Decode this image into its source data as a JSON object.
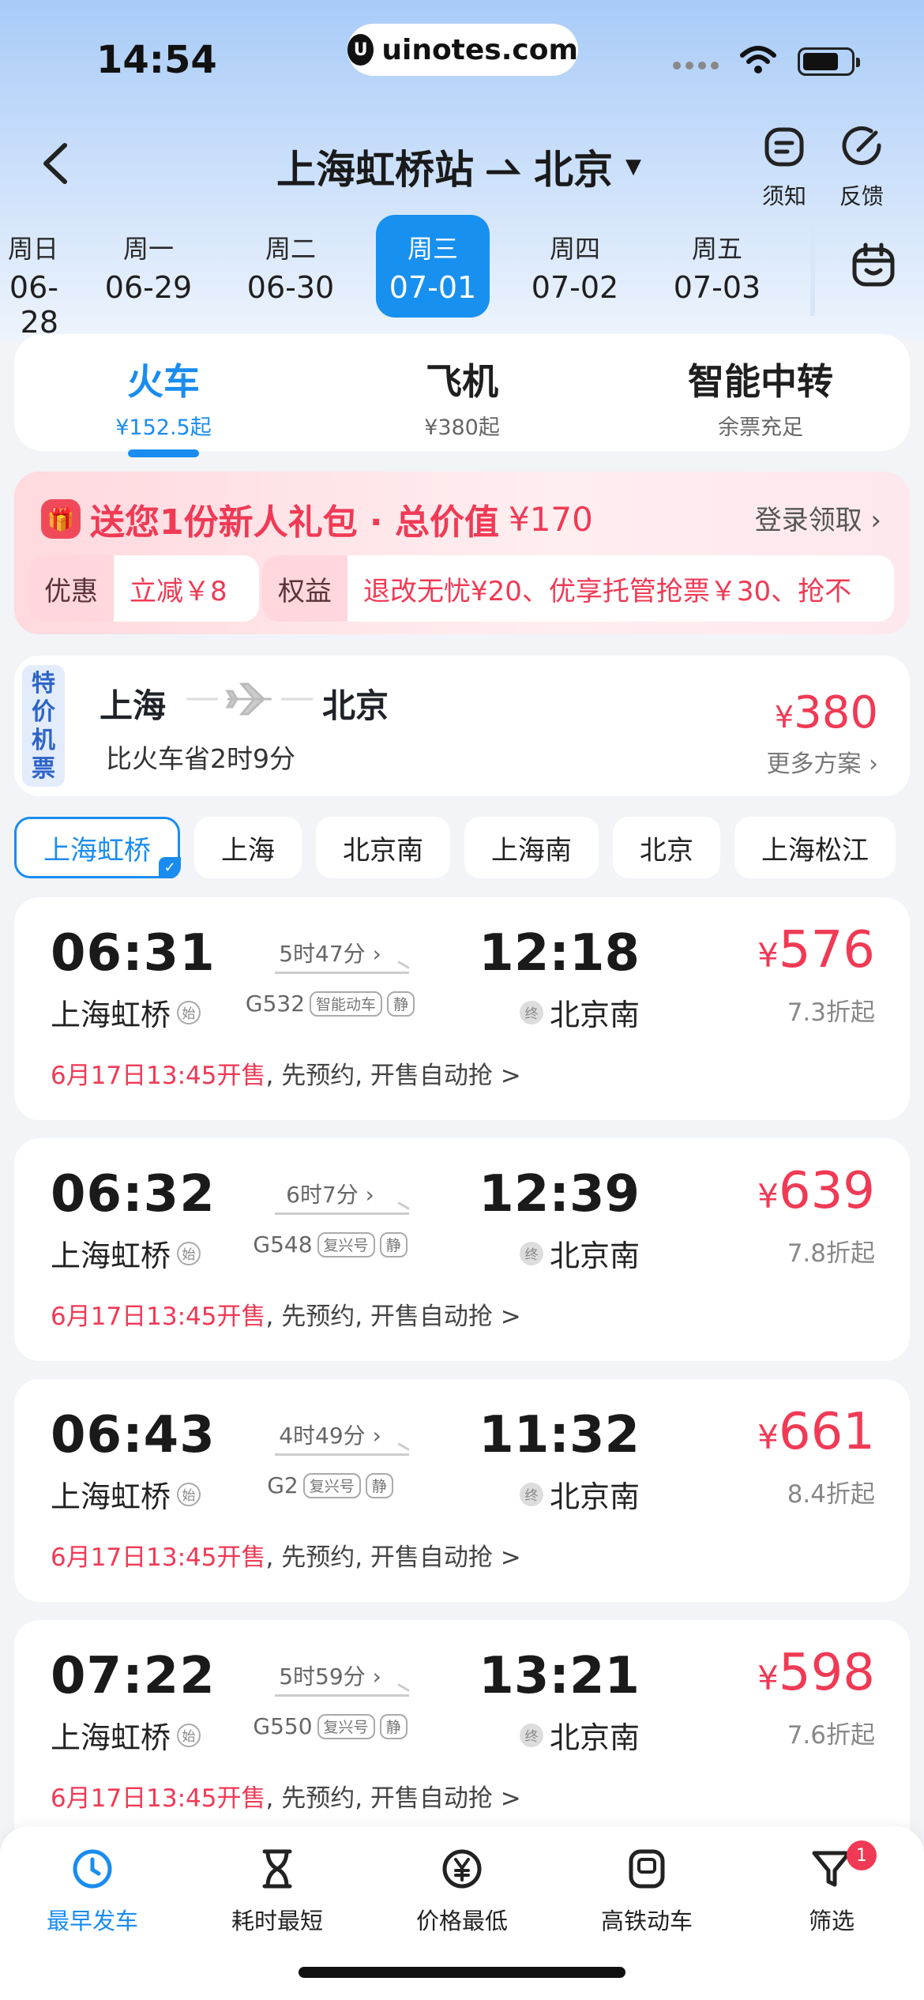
{
  "status_bar": {
    "time": "14:54",
    "watermark": "uinotes.com"
  },
  "header": {
    "from": "上海虹桥站",
    "to": "北京",
    "notice_label": "须知",
    "feedback_label": "反馈"
  },
  "dates": [
    {
      "weekday": "周日",
      "date": "06-28",
      "selected": false
    },
    {
      "weekday": "周一",
      "date": "06-29",
      "selected": false
    },
    {
      "weekday": "周二",
      "date": "06-30",
      "selected": false
    },
    {
      "weekday": "周三",
      "date": "07-01",
      "selected": true
    },
    {
      "weekday": "周四",
      "date": "07-02",
      "selected": false
    },
    {
      "weekday": "周五",
      "date": "07-03",
      "selected": false
    }
  ],
  "modes": [
    {
      "name": "火车",
      "sub": "¥152.5起",
      "active": true
    },
    {
      "name": "飞机",
      "sub": "¥380起",
      "active": false
    },
    {
      "name": "智能中转",
      "sub": "余票充足",
      "active": false
    }
  ],
  "promo": {
    "headline": "送您1份新人礼包 · 总价值",
    "amount": "¥170",
    "login_label": "登录领取",
    "chip1_label": "优惠",
    "chip1_value": "立减￥8",
    "chip2_label": "权益",
    "chip2_value": "退改无忧¥20、优享托管抢票￥30、抢不"
  },
  "flight_offer": {
    "badge": "特价机票",
    "from": "上海",
    "to": "北京",
    "desc": "比火车省2时9分",
    "price_symbol": "¥",
    "price": "380",
    "more_label": "更多方案"
  },
  "stations": [
    "上海虹桥",
    "上海",
    "北京南",
    "上海南",
    "北京",
    "上海松江"
  ],
  "trains": [
    {
      "dep": "06:31",
      "dep_station": "上海虹桥",
      "dep_tag": "始",
      "duration": "5时47分",
      "number": "G532",
      "type": "智能动车",
      "quiet": "静",
      "arr": "12:18",
      "arr_station": "北京南",
      "arr_tag": "终",
      "price": "576",
      "discount": "7.3折起",
      "sale_time": "6月17日13:45开售",
      "sale_note": ", 先预约, 开售自动抢 >"
    },
    {
      "dep": "06:32",
      "dep_station": "上海虹桥",
      "dep_tag": "始",
      "duration": "6时7分",
      "number": "G548",
      "type": "复兴号",
      "quiet": "静",
      "arr": "12:39",
      "arr_station": "北京南",
      "arr_tag": "终",
      "price": "639",
      "discount": "7.8折起",
      "sale_time": "6月17日13:45开售",
      "sale_note": ", 先预约, 开售自动抢 >"
    },
    {
      "dep": "06:43",
      "dep_station": "上海虹桥",
      "dep_tag": "始",
      "duration": "4时49分",
      "number": "G2",
      "type": "复兴号",
      "quiet": "静",
      "arr": "11:32",
      "arr_station": "北京南",
      "arr_tag": "终",
      "price": "661",
      "discount": "8.4折起",
      "sale_time": "6月17日13:45开售",
      "sale_note": ", 先预约, 开售自动抢 >"
    },
    {
      "dep": "07:22",
      "dep_station": "上海虹桥",
      "dep_tag": "始",
      "duration": "5时59分",
      "number": "G550",
      "type": "复兴号",
      "quiet": "静",
      "arr": "13:21",
      "arr_station": "北京南",
      "arr_tag": "终",
      "price": "598",
      "discount": "7.6折起",
      "sale_time": "6月17日13:45开售",
      "sale_note": ", 先预约, 开售自动抢 >"
    }
  ],
  "price_symbol": "¥",
  "bottom_nav": [
    {
      "label": "最早发车",
      "icon": "clock-icon",
      "active": true
    },
    {
      "label": "耗时最短",
      "icon": "hourglass-icon",
      "active": false
    },
    {
      "label": "价格最低",
      "icon": "yen-icon",
      "active": false
    },
    {
      "label": "高铁动车",
      "icon": "train-icon",
      "active": false
    },
    {
      "label": "筛选",
      "icon": "filter-icon",
      "active": false,
      "badge": "1"
    }
  ],
  "colors": {
    "accent": "#1a8cf0",
    "price": "#f03a55"
  }
}
